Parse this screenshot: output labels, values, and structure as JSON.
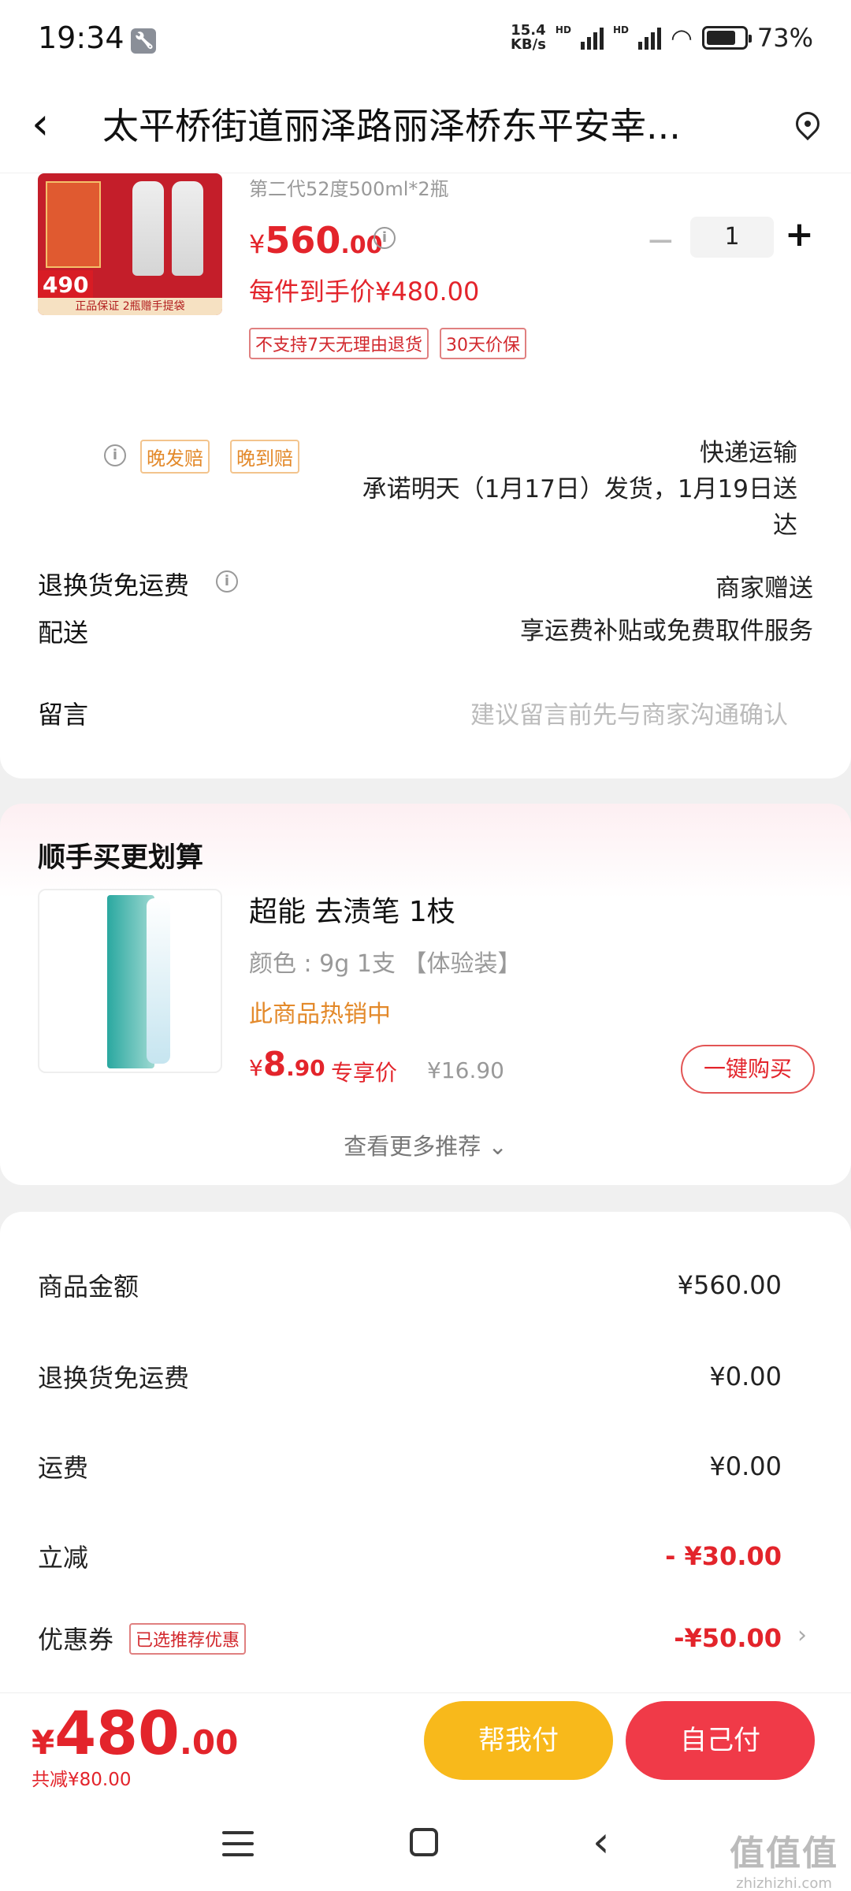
{
  "status_bar": {
    "time": "19:34",
    "net_speed_value": "15.4",
    "net_speed_unit": "KB/s",
    "hd": "HD",
    "battery": "73%"
  },
  "header": {
    "title": "太平桥街道丽泽路丽泽桥东平安幸..."
  },
  "product": {
    "spec": "第二代52度500ml*2瓶",
    "price_yen": "¥",
    "price_int": "560",
    "price_dec": ".00",
    "quantity": "1",
    "qty_minus": "−",
    "qty_plus": "+",
    "unit_price": "每件到手价¥480.00",
    "tags": [
      "不支持7天无理由退货",
      "30天价保"
    ],
    "image_badge": "490",
    "image_strip": "正品保证 2瓶赠手提袋"
  },
  "delivery": {
    "label": "配送",
    "tags": [
      "晚发赔",
      "晚到赔"
    ],
    "method": "快递运输",
    "promise_line1": "承诺明天（1月17日）发货，1月19日送",
    "promise_line2": "达"
  },
  "return_shipping": {
    "label": "退换货免运费",
    "value_line1": "商家赠送",
    "value_line2": "享运费补贴或免费取件服务"
  },
  "message": {
    "label": "留言",
    "placeholder": "建议留言前先与商家沟通确认"
  },
  "recommendation": {
    "title": "顺手买更划算",
    "item_name": "超能 去渍笔 1枝",
    "item_spec": "颜色 : 9g 1支 【体验装】",
    "item_hot": "此商品热销中",
    "price_yen": "¥",
    "price_int": "8",
    "price_dec": ".90",
    "price_label": "专享价",
    "original_price": "¥16.90",
    "buy_label": "一键购买",
    "more_label": "查看更多推荐 ⌄"
  },
  "summary": {
    "goods_label": "商品金额",
    "goods_value": "¥560.00",
    "return_label": "退换货免运费",
    "return_value": "¥0.00",
    "shipping_label": "运费",
    "shipping_value": "¥0.00",
    "discount_label": "立减",
    "discount_value": "- ¥30.00",
    "coupon_label": "优惠券",
    "coupon_tag": "已选推荐优惠",
    "coupon_value": "-¥50.00"
  },
  "bottom": {
    "total_yen": "¥",
    "total_int": "480",
    "total_dec": ".00",
    "saved": "共减¥80.00",
    "help_pay": "帮我付",
    "self_pay": "自己付"
  },
  "watermark": {
    "big": "值值值",
    "small": "zhizhizhi.com"
  },
  "colors": {
    "accent_red": "#e3242b",
    "help_yellow": "#f8b91b",
    "pay_red": "#f03a48",
    "tag_orange": "#e3892a"
  }
}
